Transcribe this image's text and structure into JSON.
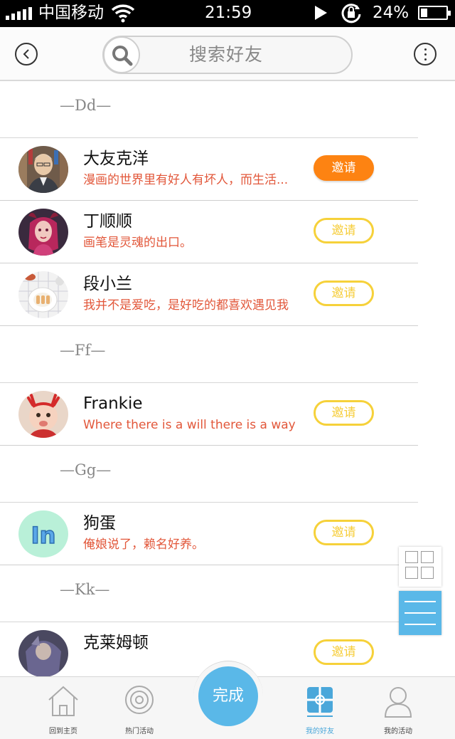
{
  "status_bar": {
    "carrier": "中国移动",
    "time": "21:59",
    "battery": "24%"
  },
  "header": {
    "search_placeholder": "搜索好友"
  },
  "sections": [
    {
      "letter": "—Dd—",
      "friends": [
        {
          "name": "大友克洋",
          "bio": "漫画的世界里有好人有坏人，而生活...",
          "invite": "邀请",
          "invite_active": true
        },
        {
          "name": "丁顺顺",
          "bio": "画笔是灵魂的出口。",
          "invite": "邀请",
          "invite_active": false
        },
        {
          "name": "段小兰",
          "bio": "我并不是爱吃，是好吃的都喜欢遇见我",
          "invite": "邀请",
          "invite_active": false
        }
      ]
    },
    {
      "letter": "—Ff—",
      "friends": [
        {
          "name": "Frankie",
          "bio": "Where there is a will there is a way",
          "invite": "邀请",
          "invite_active": false
        }
      ]
    },
    {
      "letter": "—Gg—",
      "friends": [
        {
          "name": "狗蛋",
          "bio": "俺娘说了，赖名好养。",
          "invite": "邀请",
          "invite_active": false
        }
      ]
    },
    {
      "letter": "—Kk—",
      "friends": [
        {
          "name": "克莱姆顿",
          "bio": "",
          "invite": "邀请",
          "invite_active": false
        }
      ]
    }
  ],
  "avatar_text": {
    "goudan": "In"
  },
  "bottom_nav": {
    "home": "回到主页",
    "hot": "热门活动",
    "done": "完成",
    "friends": "我的好友",
    "mine": "我的活动"
  },
  "colors": {
    "accent_blue": "#5ab8e8",
    "invite_orange": "#fd8312",
    "invite_yellow": "#f6d13a",
    "bio_red": "#e2573a"
  }
}
